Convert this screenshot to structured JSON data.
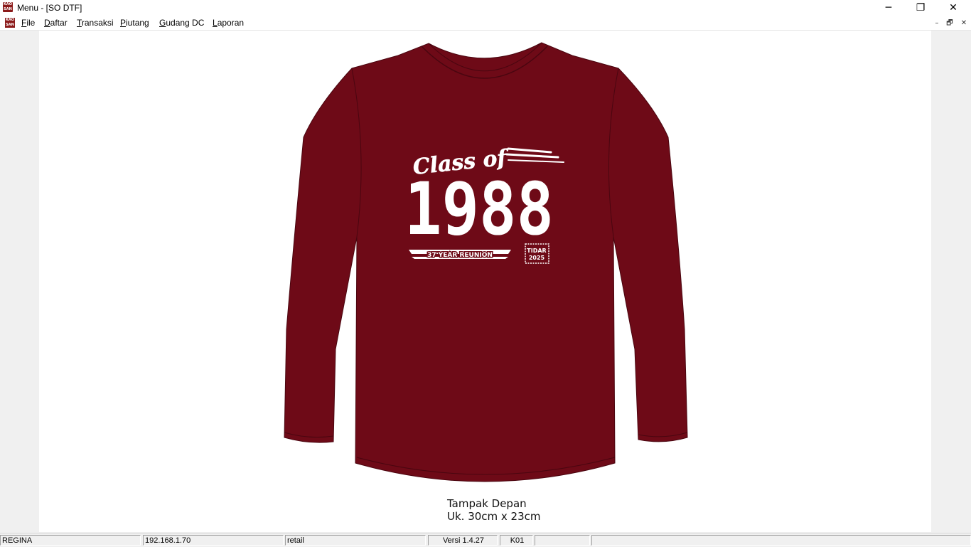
{
  "window": {
    "title": "Menu - [SO DTF]",
    "app_icon_text": "KAO SAN",
    "minimize_glyph": "─",
    "restore_glyph": "❐",
    "close_glyph": "✕"
  },
  "menubar": {
    "items": [
      {
        "acc": "F",
        "rest": "ile"
      },
      {
        "acc": "D",
        "rest": "aftar"
      },
      {
        "acc": "T",
        "rest": "ransaksi"
      },
      {
        "acc": "P",
        "rest": "iutang"
      },
      {
        "acc": "G",
        "rest": "udang DC"
      },
      {
        "acc": "L",
        "rest": "aporan"
      }
    ],
    "mdi_minimize": "–",
    "mdi_restore": "🗗",
    "mdi_close": "✕"
  },
  "design": {
    "shirt_color": "#6e0a17",
    "print_color": "#ffffff",
    "script_text": "Class of",
    "year_text": "1988",
    "banner_text": "37 YEAR REUNION",
    "badge_line1": "TIDAR",
    "badge_line2": "2025",
    "caption_line1": "Tampak Depan",
    "caption_line2": "Uk. 30cm x 23cm"
  },
  "statusbar": {
    "user": "REGINA",
    "ip": "192.168.1.70",
    "mode": "retail",
    "version": "Versi 1.4.27",
    "code": "K01",
    "extra1": "",
    "extra2": ""
  }
}
